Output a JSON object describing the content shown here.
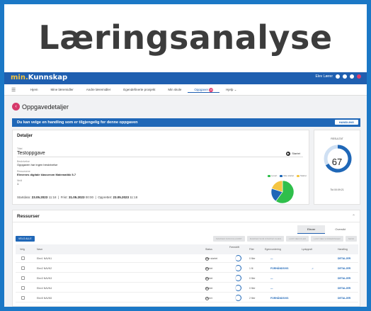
{
  "hero": {
    "title": "Læringsanalyse"
  },
  "topbar": {
    "brand_prefix": "min.",
    "brand_name": "Kunnskap",
    "user_name": "Elev Lærer"
  },
  "nav": {
    "items": [
      "Hjem",
      "Mine læremidler",
      "Andre læremidler",
      "Egendefinerte prosjekt",
      "Min skole",
      "Oppgaver",
      "Hjelp"
    ],
    "active_index": 5,
    "oppgaver_badge": "15"
  },
  "page": {
    "title": "Oppgavedetaljer"
  },
  "alert": {
    "text": "Du kan velge en handling som er tilgjengelig for denne oppgaven",
    "button": "HANDLING"
  },
  "details": {
    "heading": "Detaljer",
    "title_label": "Tittel",
    "title_value": "Testoppgave",
    "status": "Startet",
    "status_badge_icon": "play-icon",
    "desc_label": "Beskrivelse",
    "desc_value": "Oppgaven har ingen beskrivelse",
    "resource_label": "Ressursene",
    "resource_value": "Elevenes digitale klasserom Matematikk 5-7",
    "level_label": "Nivå",
    "level_value": "1",
    "start_label": "Startdato",
    "start_value": "23.05.2023",
    "start_time": "11:18",
    "due_label": "Frist",
    "due_value": "31.05.2023",
    "due_time": "00:00",
    "created_label": "Opprettet",
    "created_value": "23.05.2023",
    "created_time": "11:18",
    "legend": [
      "Levert",
      "Ikke startet",
      "Startet"
    ],
    "legend_colors": [
      "#2fbf4b",
      "#1f67b7",
      "#f4c542"
    ]
  },
  "chart_data": {
    "type": "pie",
    "labels": [
      "Levert",
      "Ikke startet",
      "Startet"
    ],
    "values": [
      60,
      20,
      20
    ],
    "colors": [
      "#2fbf4b",
      "#1f67b7",
      "#f4c542"
    ]
  },
  "result": {
    "heading": "RESULTAT",
    "value": "67",
    "time_label": "Tid",
    "time_value": "00:09:21",
    "fraction": 0.67
  },
  "resources": {
    "heading": "Ressurser",
    "tabs": [
      "Elever",
      "Oversikt"
    ],
    "select_all": "VELG ALLE",
    "actions": [
      "MARKER SOM FULLFØRT",
      "MARKER SOM STARTET IGJEN",
      "LAST NED FILER",
      "LAST NED VURDERINGER",
      "SEND"
    ],
    "columns": [
      "Velg",
      "Navn",
      "Status",
      "Fremdrift",
      "Filer",
      "Egenvurdering",
      "Lydoppslt",
      "Handling"
    ],
    "rows": [
      {
        "name": "Elev1 NAVN1",
        "status": "Ikke startet",
        "files": "0 filer",
        "self_eval": "—",
        "audio": "",
        "action": "DETALJER"
      },
      {
        "name": "Elev2 NAVN2",
        "status": "Startet",
        "files": "1 fil",
        "self_eval": "FORHÅNDSVIS",
        "audio": "♫",
        "action": "DETALJER"
      },
      {
        "name": "Elev3 NAVN3",
        "status": "Startet",
        "files": "0 filer",
        "self_eval": "—",
        "audio": "",
        "action": "DETALJER"
      },
      {
        "name": "Elev4 NAVN4",
        "status": "Startet",
        "files": "0 filer",
        "self_eval": "—",
        "audio": "",
        "action": "DETALJER"
      },
      {
        "name": "Elev5 NAVN5",
        "status": "Levert",
        "files": "2 filer",
        "self_eval": "FORHÅNDSVIS",
        "audio": "",
        "action": "DETALJER"
      }
    ]
  }
}
